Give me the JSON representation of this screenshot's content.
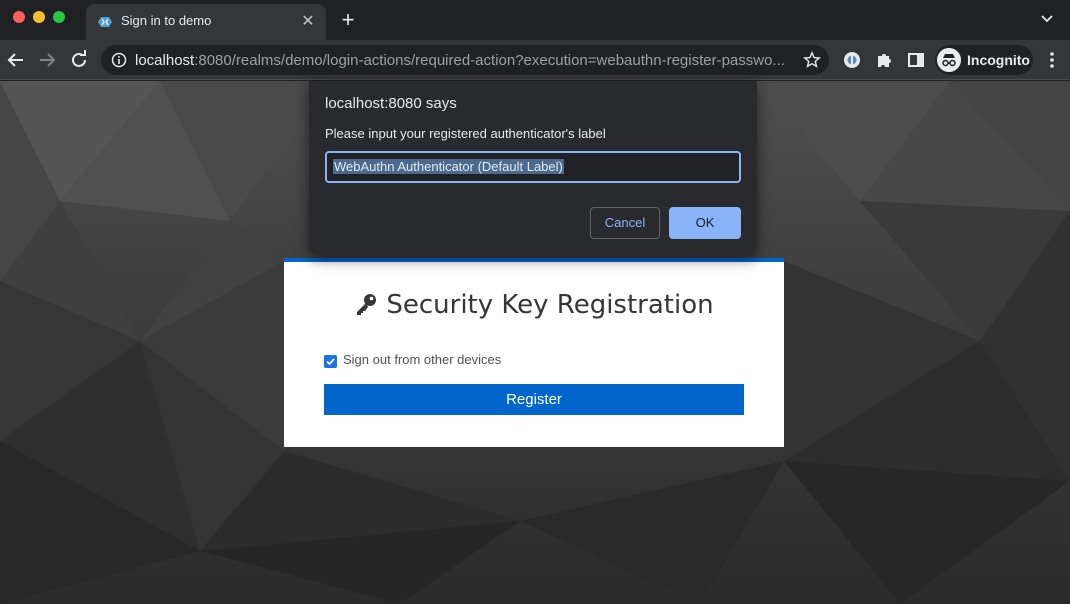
{
  "browser": {
    "tab": {
      "title": "Sign in to demo"
    },
    "url": {
      "host": "localhost",
      "rest": ":8080/realms/demo/login-actions/required-action?execution=webauthn-register-passwo..."
    },
    "incognito_label": "Incognito",
    "icons": [
      "back-arrow-icon",
      "forward-arrow-icon",
      "reload-icon",
      "info-icon",
      "star-icon",
      "extension-icon",
      "puzzle-icon",
      "side-panel-icon",
      "incognito-icon",
      "more-menu-icon"
    ]
  },
  "dialog": {
    "title": "localhost:8080 says",
    "message": "Please input your registered authenticator's label",
    "input_value": "WebAuthn Authenticator (Default Label)",
    "cancel_label": "Cancel",
    "ok_label": "OK"
  },
  "card": {
    "title": "Security Key Registration",
    "checkbox_label": "Sign out from other devices",
    "checkbox_checked": true,
    "register_label": "Register"
  },
  "colors": {
    "accent": "#0066cc",
    "dialog_button": "#8ab4f8",
    "chrome_bg": "#202124",
    "toolbar_bg": "#35363a"
  }
}
